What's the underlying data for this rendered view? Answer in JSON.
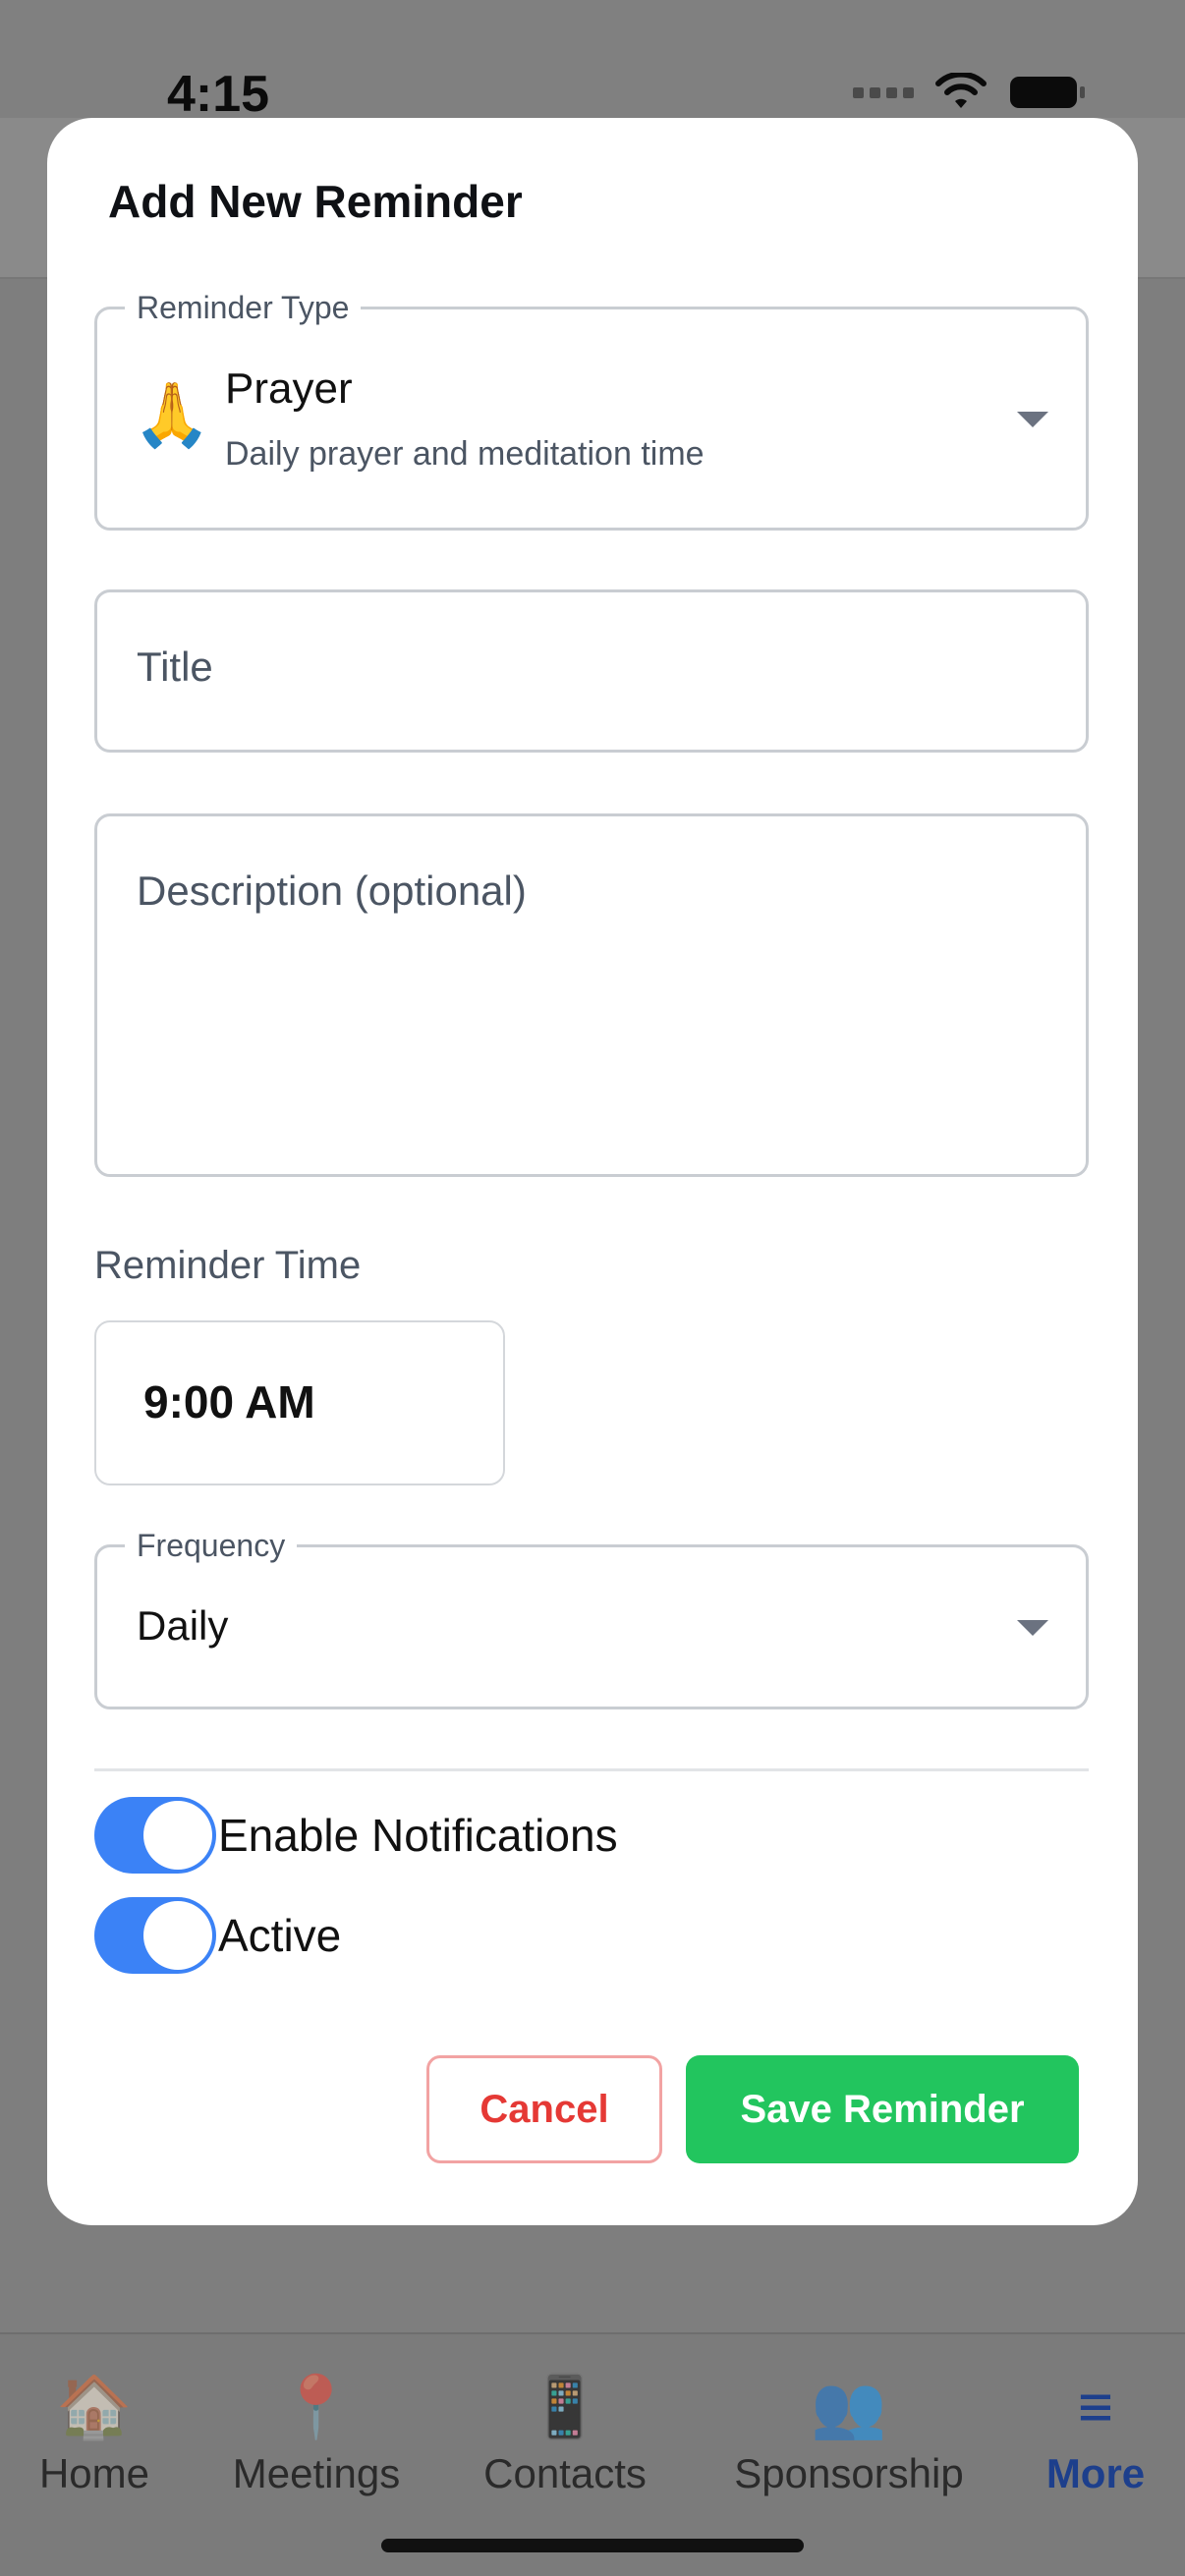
{
  "status_bar": {
    "time": "4:15"
  },
  "modal": {
    "title": "Add New Reminder",
    "reminder_type": {
      "legend": "Reminder Type",
      "emoji": "🙏",
      "name": "Prayer",
      "description": "Daily prayer and meditation time"
    },
    "title_field": {
      "placeholder": "Title",
      "value": ""
    },
    "description_field": {
      "placeholder": "Description (optional)",
      "value": ""
    },
    "reminder_time": {
      "label": "Reminder Time",
      "value": "9:00 AM"
    },
    "frequency": {
      "legend": "Frequency",
      "value": "Daily"
    },
    "toggles": {
      "notifications": {
        "label": "Enable Notifications",
        "on": true
      },
      "active": {
        "label": "Active",
        "on": true
      }
    },
    "buttons": {
      "cancel": "Cancel",
      "save": "Save Reminder"
    },
    "colors": {
      "toggle_on": "#3b82f6",
      "save": "#22c55e",
      "cancel_text": "#e53935",
      "cancel_border": "#f2a3a3"
    }
  },
  "tab_bar": {
    "items": [
      {
        "label": "Home",
        "icon": "🏠",
        "icon_name": "home-icon"
      },
      {
        "label": "Meetings",
        "icon": "📍",
        "icon_name": "pin-icon"
      },
      {
        "label": "Contacts",
        "icon": "📱",
        "icon_name": "phone-icon"
      },
      {
        "label": "Sponsorship",
        "icon": "👥",
        "icon_name": "people-icon"
      },
      {
        "label": "More",
        "icon": "≡",
        "icon_name": "menu-icon",
        "active": true
      }
    ]
  }
}
